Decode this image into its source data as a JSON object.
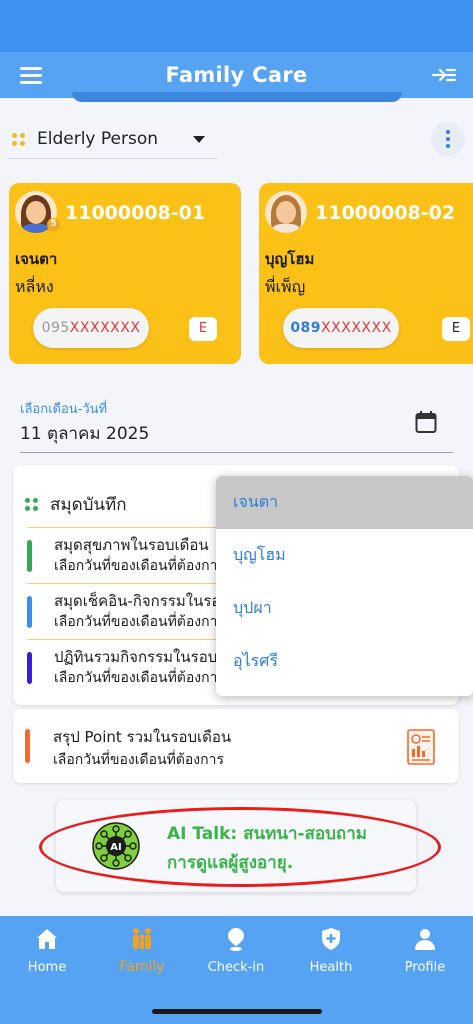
{
  "app": {
    "title": "Family Care"
  },
  "elderly_select": {
    "label": "Elderly Person"
  },
  "persons": [
    {
      "id": "11000008-01",
      "name": "เจนตา",
      "nickname": "หลี่หง",
      "phone_prefix": "095",
      "phone_mask": "XXXXXXX",
      "e_label": "E",
      "badge": "5"
    },
    {
      "id": "11000008-02",
      "name": "บุญโฮม",
      "nickname": "พี่เพ็ญ",
      "phone_prefix": "089",
      "phone_mask": "XXXXXXX",
      "e_label": "E"
    }
  ],
  "date_picker": {
    "label": "เลือกเดือน-วันที่",
    "value": "11 ตุลาคม 2025"
  },
  "notebook": {
    "title": "สมุดบันทึก",
    "items": [
      {
        "title": "สมุดสุขภาพในรอบเดือน",
        "subtitle": "เลือกวันที่ของเดือนที่ต้องการ",
        "color": "#35a853"
      },
      {
        "title": "สมุดเช็คอิน-กิจกรรมในรอบเดือน",
        "subtitle": "เลือกวันที่ของเดือนที่ต้องการ",
        "color": "#3c8fe8"
      },
      {
        "title": "ปฏิทินรวมกิจกรรมในรอบเดือน",
        "subtitle": "เลือกวันที่ของเดือนที่ต้องการ",
        "color": "#3a1fd6"
      }
    ]
  },
  "point_summary": {
    "title": "สรุป Point รวมในรอบเดือน",
    "subtitle": "เลือกวันที่ของเดือนที่ต้องการ",
    "color": "#f26a2e"
  },
  "dropdown": {
    "options": [
      "เจนตา",
      "บุญโฮม",
      "บุปผา",
      "อุไรศรี"
    ],
    "selected": "เจนตา"
  },
  "ai_talk": {
    "line1": "AI Talk: สนทนา-สอบถาม",
    "line2": "การดูแลผู้สูงอายุ.",
    "icon_text": "AI"
  },
  "nav": {
    "active": "Family",
    "items": [
      {
        "label": "Home",
        "icon": "home-icon"
      },
      {
        "label": "Family",
        "icon": "family-icon"
      },
      {
        "label": "Check-in",
        "icon": "pin-icon"
      },
      {
        "label": "Health",
        "icon": "health-shield-icon"
      },
      {
        "label": "Profile",
        "icon": "profile-icon"
      }
    ]
  },
  "colors": {
    "primary": "#55a3f2",
    "card": "#fbc117",
    "accent_orange": "#f3a21f",
    "ai_green": "#38b44a",
    "highlight_red": "#ea1c1c"
  }
}
